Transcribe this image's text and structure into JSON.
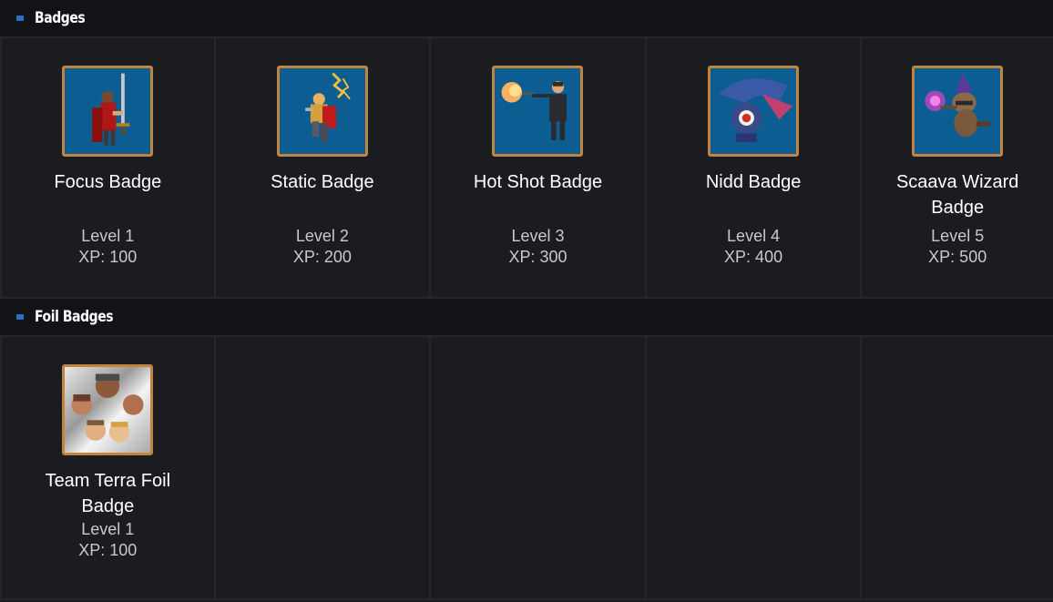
{
  "sections": [
    {
      "title": "Badges",
      "badges": [
        {
          "name": "Focus Badge",
          "level": "Level 1",
          "xp": "XP: 100",
          "icon": "knight-sword-icon"
        },
        {
          "name": "Static Badge",
          "level": "Level 2",
          "xp": "XP: 200",
          "icon": "lightning-warrior-icon"
        },
        {
          "name": "Hot Shot Badge",
          "level": "Level 3",
          "xp": "XP: 300",
          "icon": "gunslinger-icon"
        },
        {
          "name": "Nidd Badge",
          "level": "Level 4",
          "xp": "XP: 400",
          "icon": "winged-creature-icon"
        },
        {
          "name": "Scaava Wizard Badge",
          "level": "Level 5",
          "xp": "XP: 500",
          "icon": "raccoon-wizard-icon"
        }
      ]
    },
    {
      "title": "Foil Badges",
      "badges": [
        {
          "name": "Team Terra Foil Badge",
          "level": "Level 1",
          "xp": "XP: 100",
          "icon": "team-faces-icon"
        }
      ]
    }
  ],
  "colors": {
    "background": "#1b1c20",
    "header_background": "#121316",
    "accent": "#2f6fc0",
    "frame": "#c1843f",
    "badge_background": "#0b5d92"
  }
}
